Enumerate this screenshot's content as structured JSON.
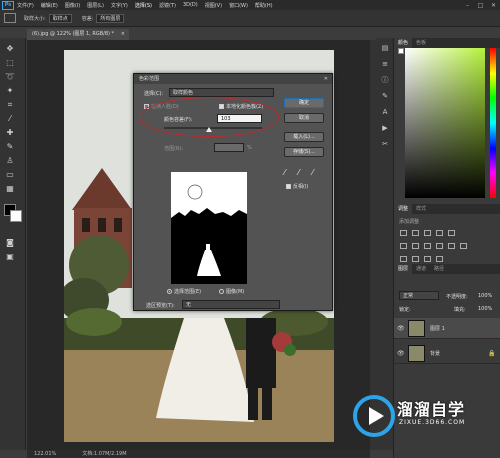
{
  "app": {
    "logo": "Ps",
    "menu": [
      "文件(F)",
      "编辑(E)",
      "图像(I)",
      "图层(L)",
      "文字(Y)",
      "选择(S)",
      "滤镜(T)",
      "3D(D)",
      "视图(V)",
      "窗口(W)",
      "帮助(H)"
    ],
    "active_menu": "选择(S)"
  },
  "options_bar": {
    "size_label": "取样大小:",
    "size_value": "取样点",
    "tolerance_label": "容差:",
    "all_layers_label": "所有图层"
  },
  "document": {
    "tab_title": "(6).jpg @ 122% (图层 1, RGB/8) *",
    "zoom": "122.01%",
    "doc_info": "文档:1.07M/2.19M"
  },
  "dialog": {
    "title": "色彩范围",
    "select_label": "选择(C):",
    "select_value": "取样颜色",
    "detect_faces_label": "检测人脸(D)",
    "localized_label": "本地化颜色簇(Z)",
    "fuzziness_label": "颜色容差(F):",
    "fuzziness_value": "103",
    "range_label": "范围(R):",
    "range_unit": "%",
    "ok": "确定",
    "cancel": "取消",
    "load": "载入(L)...",
    "save": "存储(S)...",
    "invert_label": "反相(I)",
    "radio_selection": "选择范围(E)",
    "radio_image": "图像(M)",
    "preview_label": "选区预览(T):",
    "preview_value": "无"
  },
  "panels": {
    "color_tabs": [
      "颜色",
      "色板"
    ],
    "adjust_tabs": [
      "调整",
      "样式"
    ],
    "adjust_hint": "添加调整",
    "layers_tabs": [
      "图层",
      "通道",
      "路径"
    ],
    "mode": "正常",
    "opacity_label": "不透明度:",
    "opacity": "100%",
    "lock_label": "锁定:",
    "fill_label": "填充:",
    "fill": "100%",
    "layers": [
      {
        "name": "图层 1"
      },
      {
        "name": "背景"
      }
    ]
  },
  "watermark": {
    "title": "溜溜自学",
    "url": "ZIXUE.3D66.COM"
  },
  "colors": {
    "accent": "#31a8ff",
    "annotation": "#c0282c"
  }
}
